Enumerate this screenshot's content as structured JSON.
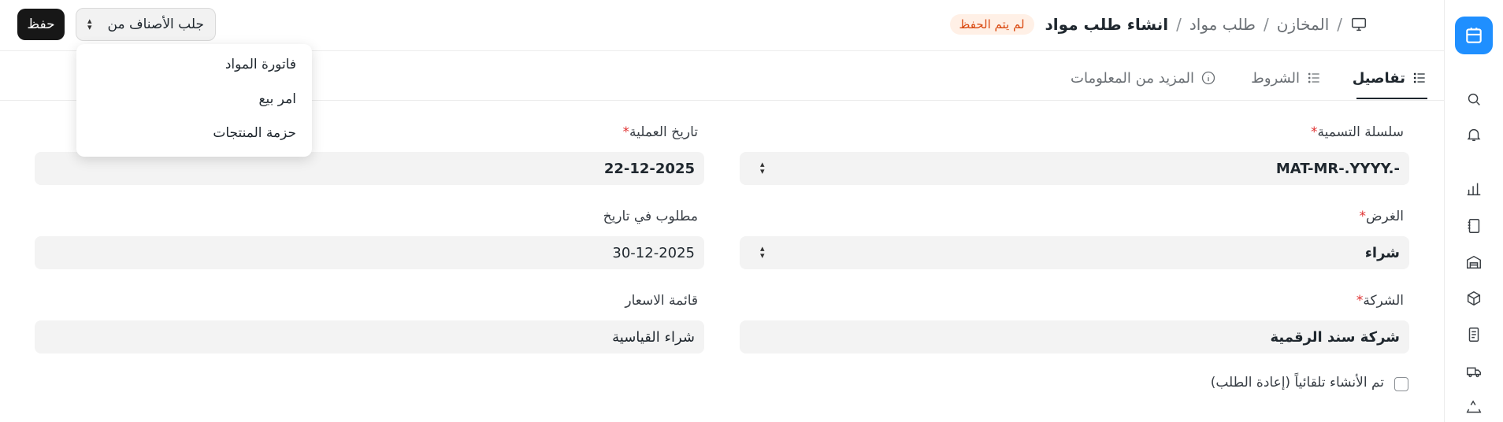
{
  "header": {
    "save_label": "حفظ",
    "fetch_items_label": "جلب الأصناف من",
    "breadcrumb": [
      "المخازن",
      "طلب مواد",
      "انشاء طلب مواد"
    ],
    "status_badge": "لم يتم الحفظ"
  },
  "dropdown": {
    "items": [
      "فاتورة المواد",
      "امر بيع",
      "حزمة المنتجات"
    ]
  },
  "tabs": [
    {
      "label": "تفاصيل",
      "active": true,
      "icon": "list-icon"
    },
    {
      "label": "الشروط",
      "active": false,
      "icon": "list-icon"
    },
    {
      "label": "المزيد من المعلومات",
      "active": false,
      "icon": "info-icon"
    }
  ],
  "form": {
    "naming_series": {
      "label": "سلسلة التسمية",
      "value": "MAT-MR-.YYYY.-"
    },
    "transaction_date": {
      "label": "تاريخ العملية",
      "value": "22-12-2025"
    },
    "purpose": {
      "label": "الغرض",
      "value": "شراء"
    },
    "required_by": {
      "label": "مطلوب في تاريخ",
      "value": "30-12-2025"
    },
    "company": {
      "label": "الشركة",
      "value": "شركة سند الرقمية"
    },
    "price_list": {
      "label": "قائمة الاسعار",
      "value": "شراء القياسية"
    },
    "auto_created": {
      "label": "تم الأنشاء تلقائياً (إعادة الطلب)",
      "checked": false
    }
  },
  "sidebar": {
    "icons": [
      "app-logo-icon",
      "search-icon",
      "bell-icon",
      "bar-chart-icon",
      "notebook-icon",
      "warehouse-icon",
      "box-icon",
      "document-icon",
      "truck-icon",
      "recycle-icon"
    ]
  },
  "colors": {
    "accent": "#1f8fff",
    "badge_bg": "#fff0e6",
    "badge_text": "#d9480f",
    "required": "#e03131"
  }
}
